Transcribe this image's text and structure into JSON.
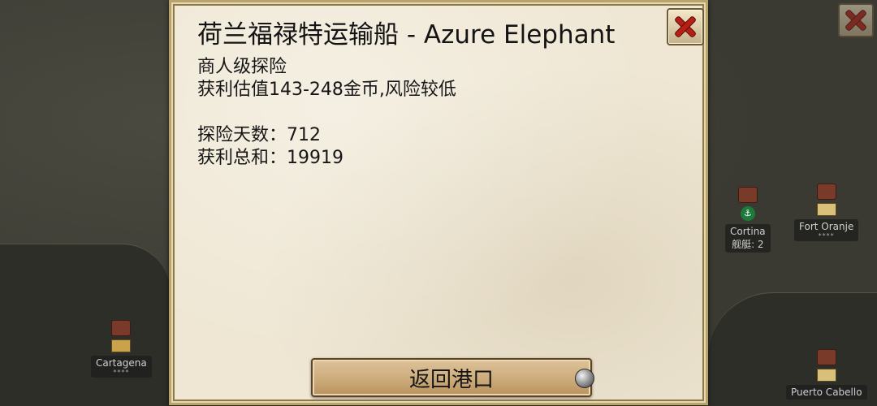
{
  "dialog": {
    "title": "荷兰福禄特运输船 - Azure Elephant",
    "expedition_level": "商人级探险",
    "profit_estimate": "获利估值143-248金币,风险较低",
    "days_label": "探险天数：712",
    "total_label": "获利总和：19919",
    "return_button": "返回港口",
    "close_icon": "close-x-icon"
  },
  "map": {
    "ports": [
      {
        "name": "Cartagena",
        "stars": "****"
      },
      {
        "name": "Cortina",
        "extra": "舰艇: 2"
      },
      {
        "name": "Fort Oranje",
        "stars": "****"
      },
      {
        "name": "Puerto Cabello"
      }
    ]
  },
  "colors": {
    "parchment": "#efe7d4",
    "close_red": "#b51f14",
    "button_tan": "#cfae7e"
  }
}
